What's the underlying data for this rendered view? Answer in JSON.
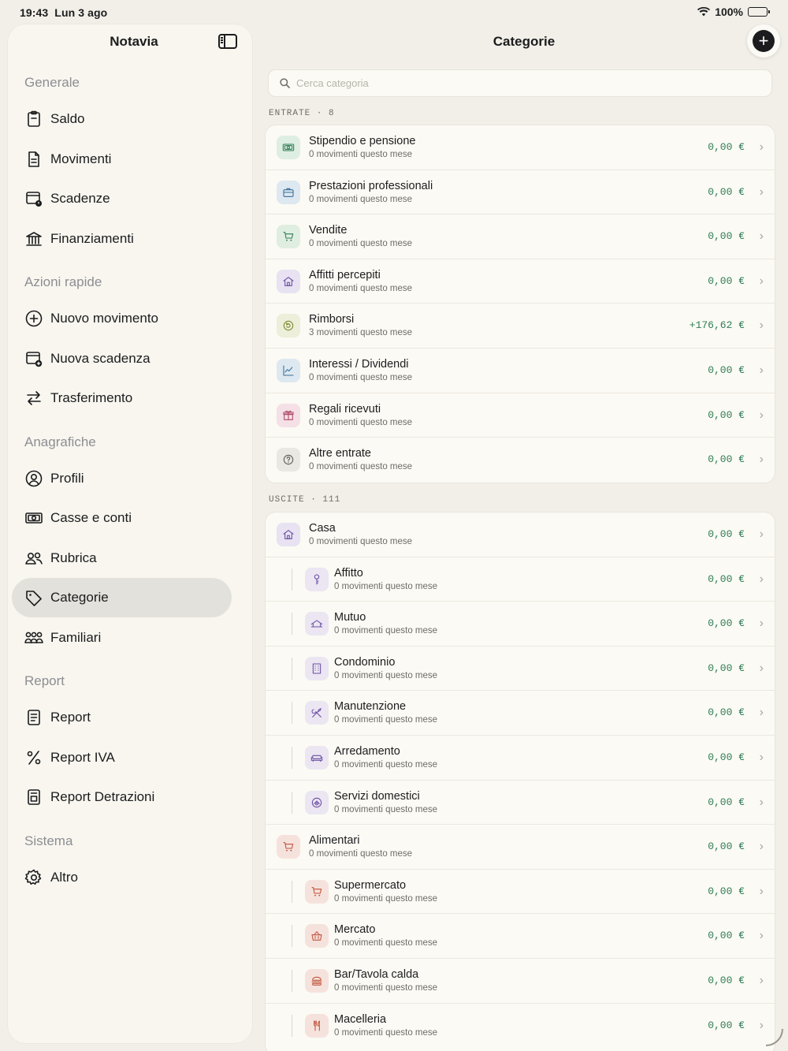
{
  "status_bar": {
    "time": "19:43",
    "date": "Lun 3 ago",
    "battery": "100%"
  },
  "sidebar": {
    "title": "Notavia",
    "sections": [
      {
        "label": "Generale",
        "items": [
          {
            "label": "Saldo",
            "icon": "clipboard-icon"
          },
          {
            "label": "Movimenti",
            "icon": "document-icon"
          },
          {
            "label": "Scadenze",
            "icon": "calendar-clock-icon"
          },
          {
            "label": "Finanziamenti",
            "icon": "bank-icon"
          }
        ]
      },
      {
        "label": "Azioni rapide",
        "items": [
          {
            "label": "Nuovo movimento",
            "icon": "plus-circle-icon"
          },
          {
            "label": "Nuova scadenza",
            "icon": "calendar-plus-icon"
          },
          {
            "label": "Trasferimento",
            "icon": "transfer-arrows-icon"
          }
        ]
      },
      {
        "label": "Anagrafiche",
        "items": [
          {
            "label": "Profili",
            "icon": "person-circle-icon"
          },
          {
            "label": "Casse e conti",
            "icon": "banknote-icon"
          },
          {
            "label": "Rubrica",
            "icon": "people-icon"
          },
          {
            "label": "Categorie",
            "icon": "tag-icon",
            "active": true
          },
          {
            "label": "Familiari",
            "icon": "family-icon"
          }
        ]
      },
      {
        "label": "Report",
        "items": [
          {
            "label": "Report",
            "icon": "report-doc-icon"
          },
          {
            "label": "Report IVA",
            "icon": "percent-icon"
          },
          {
            "label": "Report Detrazioni",
            "icon": "report-image-icon"
          }
        ]
      },
      {
        "label": "Sistema",
        "items": [
          {
            "label": "Altro",
            "icon": "gear-icon"
          }
        ]
      }
    ]
  },
  "main": {
    "title": "Categorie",
    "search_placeholder": "Cerca categoria",
    "income_label": "ENTRATE · 8",
    "expense_label": "USCITE · 111",
    "income": [
      {
        "name": "Stipendio e pensione",
        "sub": "0 movimenti questo mese",
        "amount": "0,00 €",
        "icon": "banknote-icon",
        "bg": "#dfeee3",
        "fg": "#2f7d55"
      },
      {
        "name": "Prestazioni professionali",
        "sub": "0 movimenti questo mese",
        "amount": "0,00 €",
        "icon": "briefcase-icon",
        "bg": "#dde8f1",
        "fg": "#3b6e99"
      },
      {
        "name": "Vendite",
        "sub": "0 movimenti questo mese",
        "amount": "0,00 €",
        "icon": "cart-icon",
        "bg": "#e0eee2",
        "fg": "#2f7d55"
      },
      {
        "name": "Affitti percepiti",
        "sub": "0 movimenti questo mese",
        "amount": "0,00 €",
        "icon": "house-icon",
        "bg": "#e8e2f2",
        "fg": "#6c4fa3"
      },
      {
        "name": "Rimborsi",
        "sub": "3 movimenti questo mese",
        "amount": "+176,62 €",
        "icon": "refund-icon",
        "bg": "#ecefd9",
        "fg": "#7d8a2f"
      },
      {
        "name": "Interessi / Dividendi",
        "sub": "0 movimenti questo mese",
        "amount": "0,00 €",
        "icon": "chart-icon",
        "bg": "#dde8f1",
        "fg": "#3b6e99"
      },
      {
        "name": "Regali ricevuti",
        "sub": "0 movimenti questo mese",
        "amount": "0,00 €",
        "icon": "gift-icon",
        "bg": "#f4e0e6",
        "fg": "#b04a6a"
      },
      {
        "name": "Altre entrate",
        "sub": "0 movimenti questo mese",
        "amount": "0,00 €",
        "icon": "question-icon",
        "bg": "#eae8e2",
        "fg": "#5b5954"
      }
    ],
    "expenses": [
      {
        "name": "Casa",
        "sub": "0 movimenti questo mese",
        "amount": "0,00 €",
        "icon": "house-icon",
        "bg": "#e8e2f2",
        "fg": "#6c4fa3",
        "child": false
      },
      {
        "name": "Affitto",
        "sub": "0 movimenti questo mese",
        "amount": "0,00 €",
        "icon": "key-icon",
        "bg": "#ebe6f2",
        "fg": "#6c4fa3",
        "child": true
      },
      {
        "name": "Mutuo",
        "sub": "0 movimenti questo mese",
        "amount": "0,00 €",
        "icon": "house-loan-icon",
        "bg": "#ebe6f2",
        "fg": "#6c4fa3",
        "child": true
      },
      {
        "name": "Condominio",
        "sub": "0 movimenti questo mese",
        "amount": "0,00 €",
        "icon": "building-icon",
        "bg": "#ebe6f2",
        "fg": "#6c4fa3",
        "child": true
      },
      {
        "name": "Manutenzione",
        "sub": "0 movimenti questo mese",
        "amount": "0,00 €",
        "icon": "tools-icon",
        "bg": "#ebe6f2",
        "fg": "#6c4fa3",
        "child": true
      },
      {
        "name": "Arredamento",
        "sub": "0 movimenti questo mese",
        "amount": "0,00 €",
        "icon": "sofa-icon",
        "bg": "#ebe6f2",
        "fg": "#6c4fa3",
        "child": true
      },
      {
        "name": "Servizi domestici",
        "sub": "0 movimenti questo mese",
        "amount": "0,00 €",
        "icon": "housekeeping-icon",
        "bg": "#ebe6f2",
        "fg": "#6c4fa3",
        "child": true
      },
      {
        "name": "Alimentari",
        "sub": "0 movimenti questo mese",
        "amount": "0,00 €",
        "icon": "cart-icon",
        "bg": "#f6e2dd",
        "fg": "#c0533a",
        "child": false
      },
      {
        "name": "Supermercato",
        "sub": "0 movimenti questo mese",
        "amount": "0,00 €",
        "icon": "cart-icon",
        "bg": "#f6e2dd",
        "fg": "#c0533a",
        "child": true
      },
      {
        "name": "Mercato",
        "sub": "0 movimenti questo mese",
        "amount": "0,00 €",
        "icon": "basket-icon",
        "bg": "#f6e2dd",
        "fg": "#c0533a",
        "child": true
      },
      {
        "name": "Bar/Tavola calda",
        "sub": "0 movimenti questo mese",
        "amount": "0,00 €",
        "icon": "burger-icon",
        "bg": "#f6e2dd",
        "fg": "#c0533a",
        "child": true
      },
      {
        "name": "Macelleria",
        "sub": "0 movimenti questo mese",
        "amount": "0,00 €",
        "icon": "fork-knife-icon",
        "bg": "#f6e2dd",
        "fg": "#c0533a",
        "child": true
      }
    ]
  }
}
